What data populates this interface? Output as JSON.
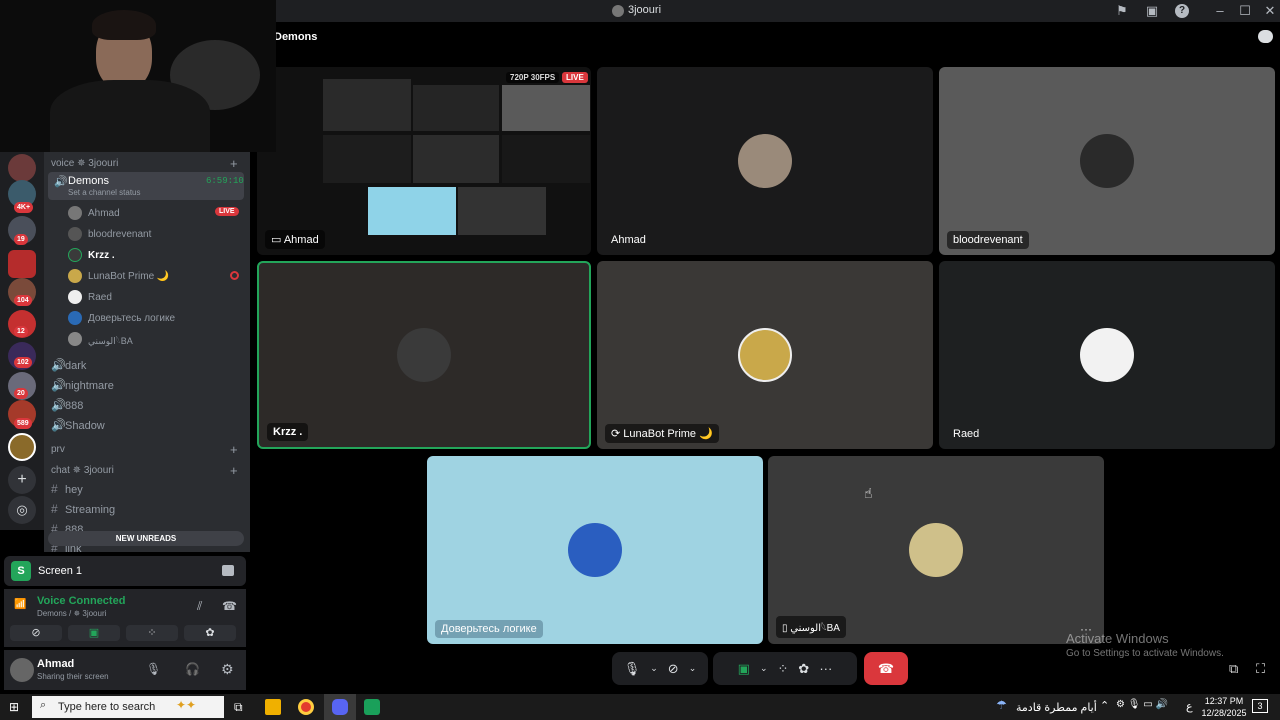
{
  "window": {
    "title": "3joouri"
  },
  "header": {
    "channel": "Demons"
  },
  "sidebar": {
    "voice_category": "voice ✵ 3joouri",
    "active_channel": {
      "name": "Demons",
      "timer": "6:59:10",
      "status": "Set a channel status"
    },
    "voice_users": [
      {
        "name": "Ahmad",
        "badge": "LIVE"
      },
      {
        "name": "bloodrevenant"
      },
      {
        "name": "Krzz ."
      },
      {
        "name": "LunaBot Prime 🌙"
      },
      {
        "name": "Raed"
      },
      {
        "name": "Доверьтесь логике"
      },
      {
        "name": "الوسني𓆩BA"
      }
    ],
    "voice_channels": [
      "dark",
      "nightmare",
      "888",
      "Shadow"
    ],
    "prv_category": "prv",
    "chat_category": "chat ✵ 3joouri",
    "text_channels": [
      "hey",
      "Streaming",
      "888",
      "link"
    ],
    "new_unreads": "NEW UNREADS"
  },
  "servers": {
    "badges": [
      "4K+",
      "19",
      "104",
      "12",
      "102",
      "20",
      "589"
    ]
  },
  "screen_panel": {
    "label": "Screen 1"
  },
  "voice_panel": {
    "status": "Voice Connected",
    "location": "Demons / ✵ 3joouri"
  },
  "user_panel": {
    "name": "Ahmad",
    "status": "Sharing their screen"
  },
  "stream_tile": {
    "quality": "720P 30FPS",
    "live": "LIVE",
    "name": "Ahmad"
  },
  "tiles": [
    {
      "name": "Ahmad"
    },
    {
      "name": "bloodrevenant"
    },
    {
      "name": "Krzz ."
    },
    {
      "name": "LunaBot Prime 🌙"
    },
    {
      "name": "Raed"
    },
    {
      "name": "Доверьтесь логике"
    },
    {
      "name": "الوسني𓆩BA"
    }
  ],
  "watermark": {
    "line1": "Activate Windows",
    "line2": "Go to Settings to activate Windows."
  },
  "taskbar": {
    "search_placeholder": "Type here to search",
    "weather": "أيام ممطرة قادمة",
    "lang": "ع",
    "time": "12:37 PM",
    "date": "12/28/2025",
    "notifications": "3"
  },
  "colors": {
    "accent_green": "#23a55a",
    "live_red": "#da373c",
    "blurple": "#5865f2",
    "hangup": "#da373c"
  }
}
